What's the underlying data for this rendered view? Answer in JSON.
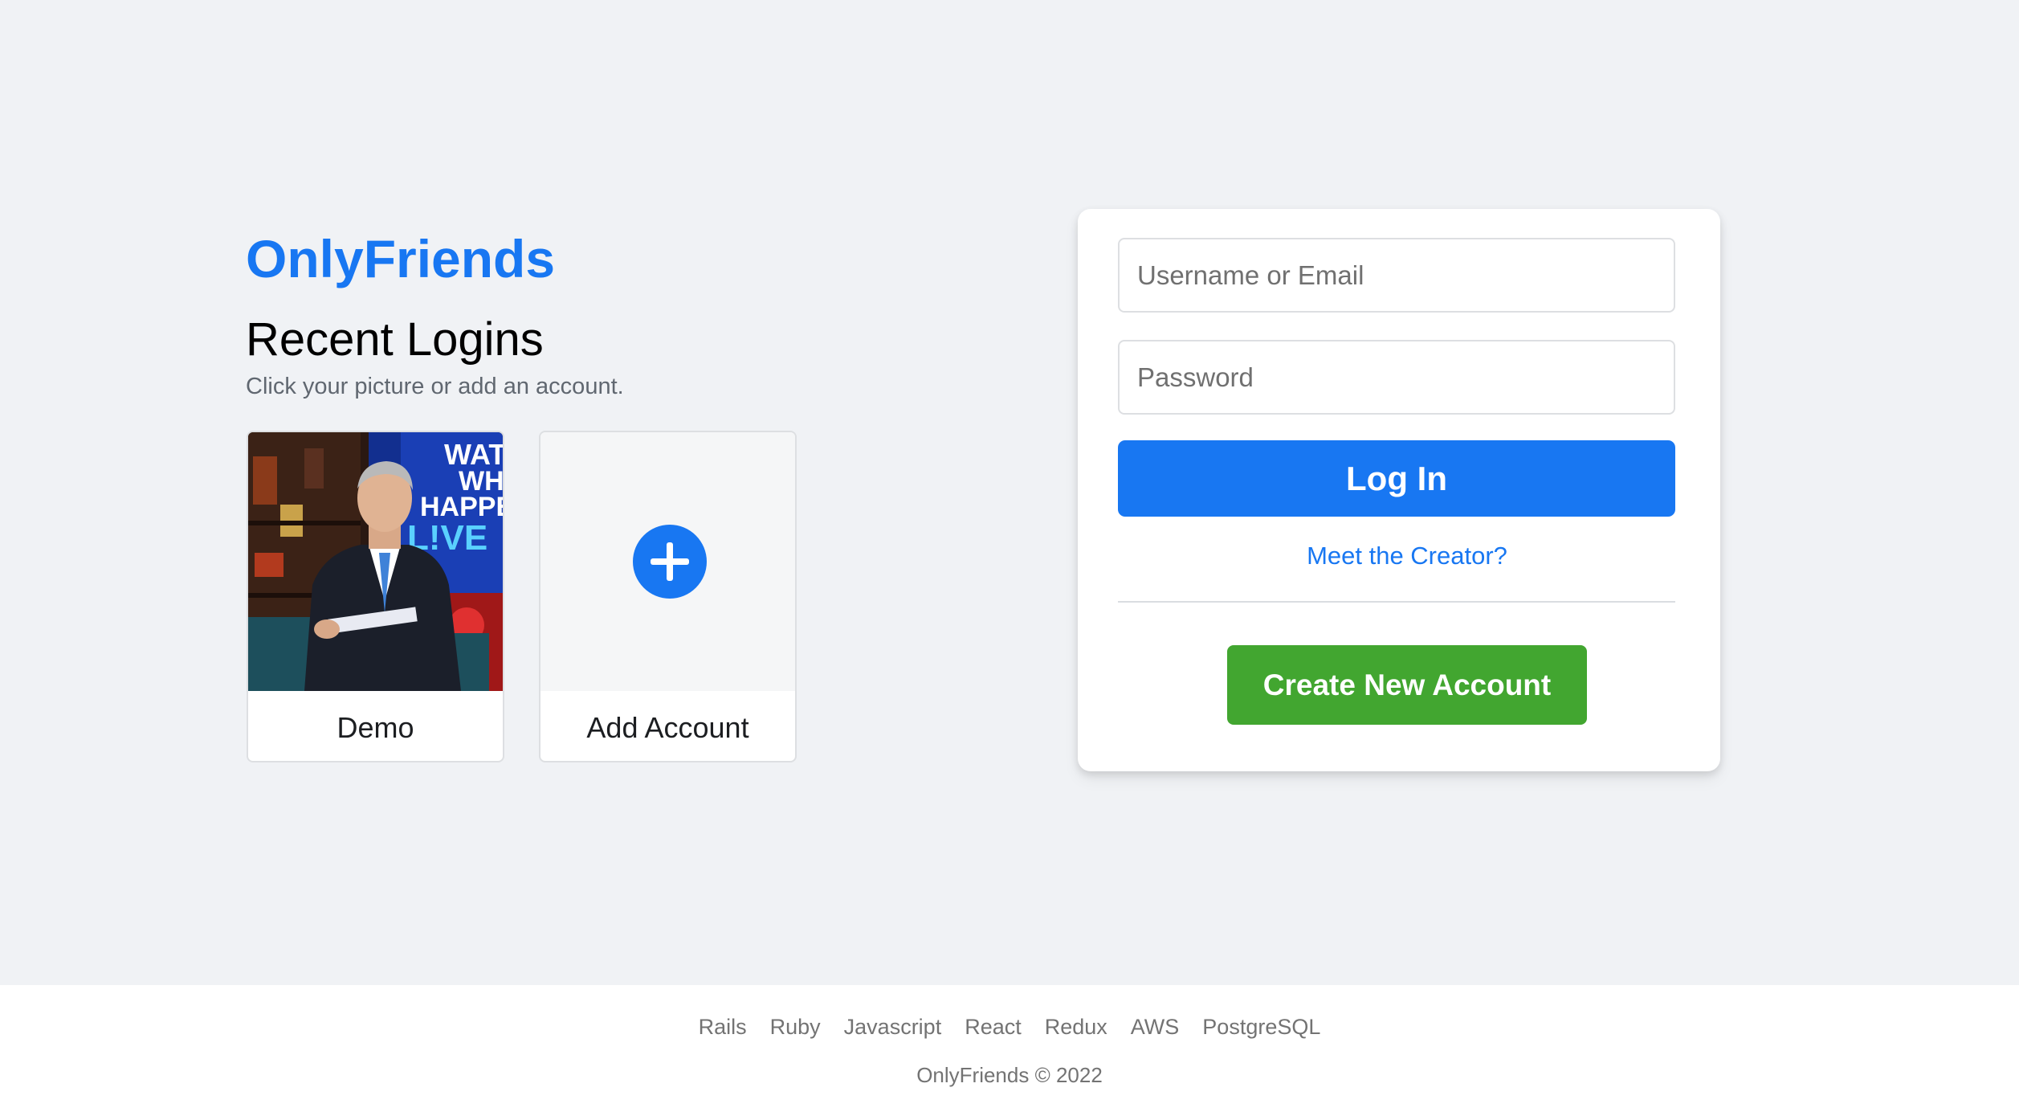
{
  "brand": {
    "name": "OnlyFriends",
    "color": "#1877f2"
  },
  "recent_logins": {
    "title": "Recent Logins",
    "subtitle": "Click your picture or add an account.",
    "accounts": [
      {
        "label": "Demo",
        "image": "profile-photo"
      }
    ],
    "add_account": {
      "label": "Add Account",
      "icon": "plus-circle-icon"
    }
  },
  "login_form": {
    "username_placeholder": "Username or Email",
    "password_placeholder": "Password",
    "login_label": "Log In",
    "creator_link": "Meet the Creator?",
    "create_account_label": "Create New Account",
    "primary_color": "#1877f2",
    "create_color": "#42a630"
  },
  "footer": {
    "links": [
      {
        "label": "Rails"
      },
      {
        "label": "Ruby"
      },
      {
        "label": "Javascript"
      },
      {
        "label": "React"
      },
      {
        "label": "Redux"
      },
      {
        "label": "AWS"
      },
      {
        "label": "PostgreSQL"
      }
    ],
    "copyright": "OnlyFriends © 2022"
  }
}
